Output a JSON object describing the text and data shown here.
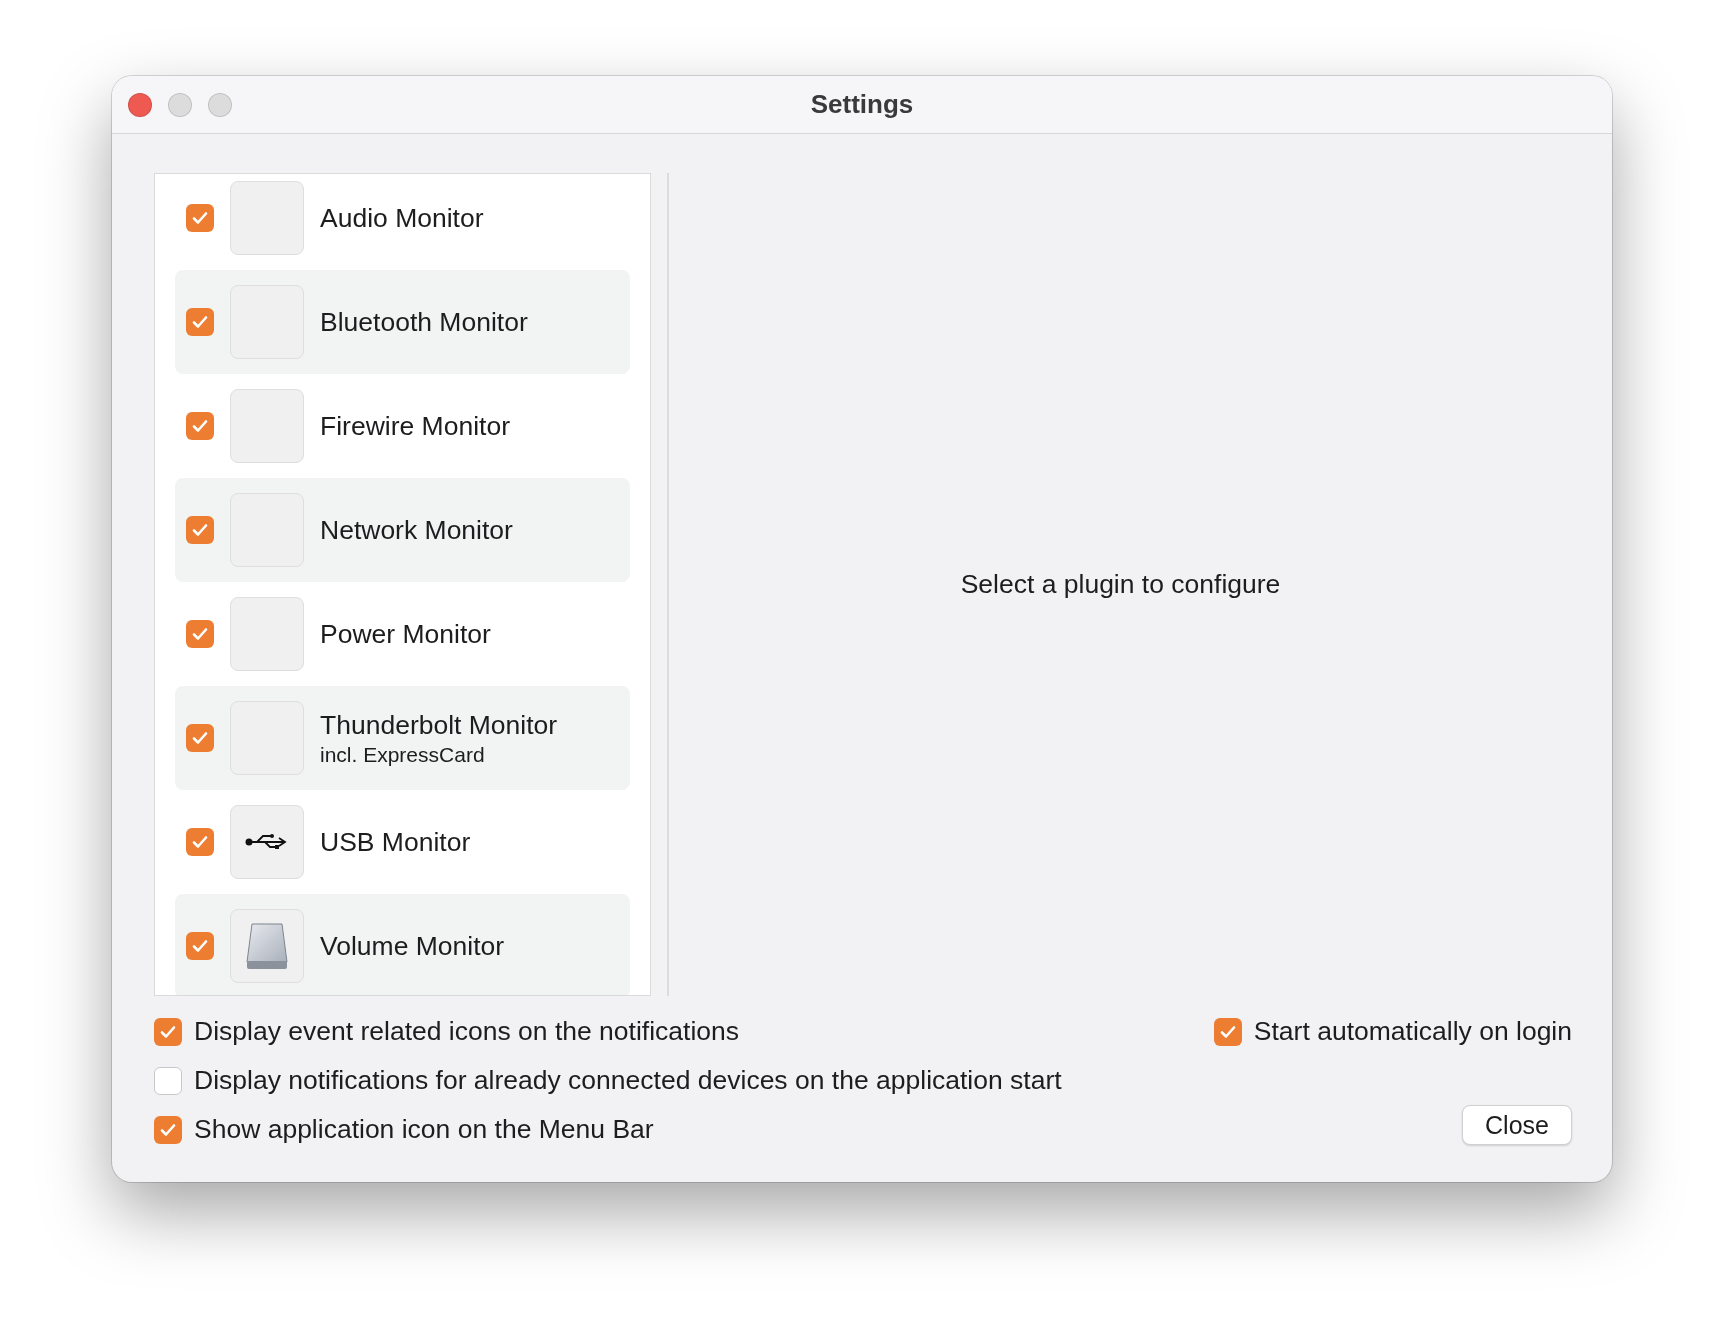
{
  "window": {
    "title": "Settings"
  },
  "plugins": [
    {
      "name": "Audio Monitor",
      "checked": true,
      "kind": "blank"
    },
    {
      "name": "Bluetooth Monitor",
      "checked": true,
      "kind": "blank"
    },
    {
      "name": "Firewire Monitor",
      "checked": true,
      "kind": "blank"
    },
    {
      "name": "Network Monitor",
      "checked": true,
      "kind": "blank"
    },
    {
      "name": "Power Monitor",
      "checked": true,
      "kind": "blank"
    },
    {
      "name": "Thunderbolt Monitor",
      "subtitle": "incl. ExpressCard",
      "checked": true,
      "kind": "blank"
    },
    {
      "name": "USB Monitor",
      "checked": true,
      "kind": "usb"
    },
    {
      "name": "Volume Monitor",
      "checked": true,
      "kind": "drive"
    }
  ],
  "detail": {
    "placeholder": "Select a plugin to configure"
  },
  "options": [
    {
      "label": "Display event related icons on the notifications",
      "checked": true
    },
    {
      "label": "Display notifications for already connected devices on the application start",
      "checked": false
    },
    {
      "label": "Show application icon on the Menu Bar",
      "checked": true
    }
  ],
  "login_option": {
    "label": "Start automatically on login",
    "checked": true
  },
  "buttons": {
    "close": "Close"
  }
}
